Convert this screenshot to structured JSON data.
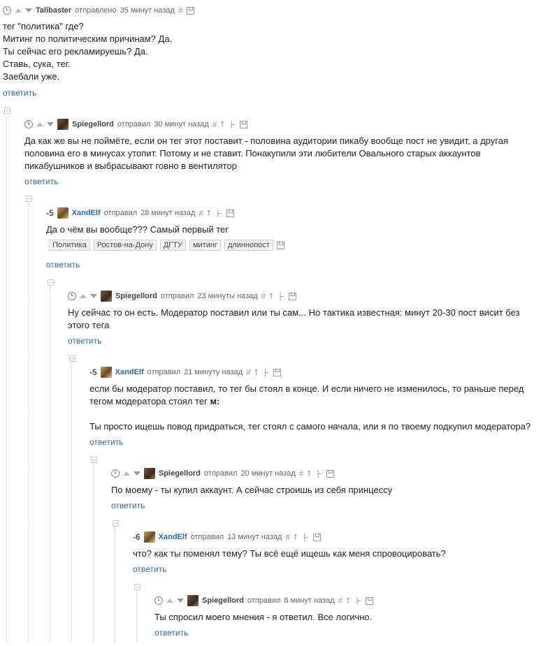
{
  "comments": [
    {
      "user": "Talibaster",
      "action": "отправлено",
      "time": "35 минут назад",
      "lines": [
        "тег \"политика\" где?",
        "Митинг по политическим причинам? Да.",
        "Ты сейчас его рекламируешь? Да.",
        "Ставь, сука, тег.",
        "Заебали уже."
      ],
      "reply": "ответить"
    },
    {
      "user": "Spiegellord",
      "action": "отправил",
      "time": "30 минут назад",
      "lines": [
        "Да как же вы не поймёте, если он тег этот поставит - половина аудитории пикабу вообще пост не увидит, а другая",
        "половина его в минусах утопит. Потому и не ставит. Понакупили эти любители Овального старых аккаунтов",
        "пикабушников и выбрасывают говно в вентилятор"
      ],
      "reply": "ответить"
    },
    {
      "rating": "-5",
      "user": "XandElf",
      "action": "отправил",
      "time": "28 минут назад",
      "lines": [
        "Да о чём вы вообще??? Самый первый тег"
      ],
      "tags": [
        "Политика",
        "Ростов-на-Дону",
        "ДГТУ",
        "митинг",
        "длиннопост"
      ],
      "reply": "ответить"
    },
    {
      "user": "Spiegellord",
      "action": "отправил",
      "time": "23 минуты назад",
      "lines": [
        "Ну сейчас то он есть. Модератор поставил или ты сам... Но тактика известная: минут 20-30 пост висит без",
        "этого тега"
      ],
      "reply": "ответить"
    },
    {
      "rating": "-5",
      "user": "XandElf",
      "action": "отправил",
      "time": "21 минуту назад",
      "lines": [
        "если бы модератор поставил, то тег бы стоял в конце. И если ничего не изменилось, то раньше перед",
        "тегом модератора стоял тег"
      ],
      "bold_word": "м:",
      "lines2": [
        "Ты просто ищешь повод придраться, тег стоял с самого начала, или я по твоему подкупил модератора?"
      ],
      "reply": "ответить"
    },
    {
      "user": "Spiegellord",
      "action": "отправил",
      "time": "20 минут назад",
      "lines": [
        "По моему - ты купил аккаунт. А сейчас строишь из себя принцессу"
      ],
      "reply": "ответить"
    },
    {
      "rating": "-6",
      "user": "XandElf",
      "action": "отправил",
      "time": "13 минут назад",
      "lines": [
        "что? как ты поменял тему? Ты всё ещё ищешь как меня спровоцировать?"
      ],
      "reply": "ответить"
    },
    {
      "user": "Spiegellord",
      "action": "отправил",
      "time": "8 минут назад",
      "lines": [
        "Ты спросил моего мнения - я ответил. Все логично."
      ],
      "reply": "ответить"
    }
  ],
  "icons": {
    "permalink": "#",
    "up": "⭡",
    "branch": "⺊"
  }
}
